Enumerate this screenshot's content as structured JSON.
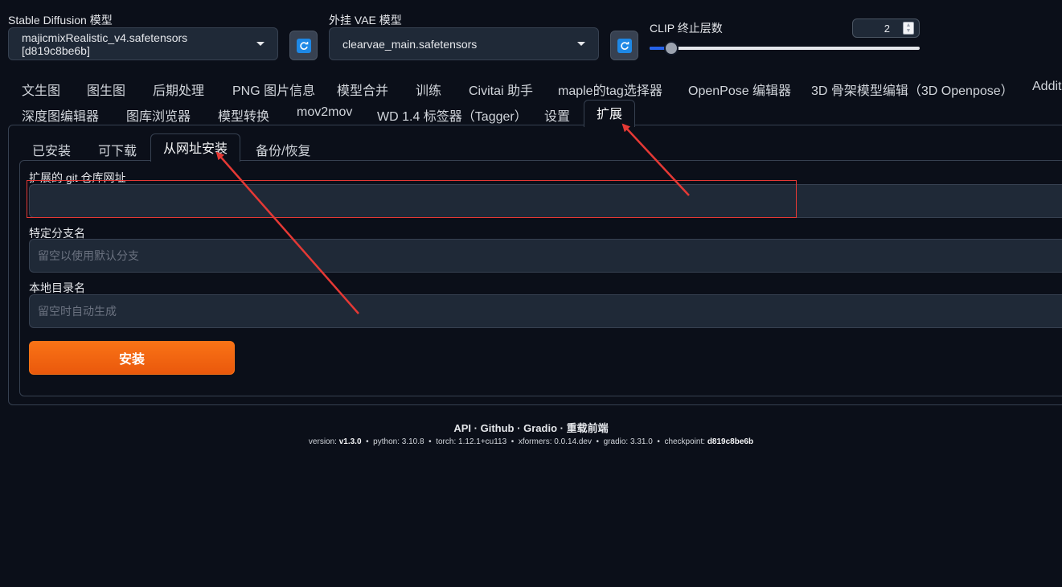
{
  "header": {
    "sd_model_label": "Stable Diffusion 模型",
    "sd_model_value": "majicmixRealistic_v4.safetensors [d819c8be6b]",
    "vae_label": "外挂 VAE 模型",
    "vae_value": "clearvae_main.safetensors",
    "clip_label": "CLIP 终止层数",
    "clip_value": "2",
    "clip_slider_fraction": 0.08,
    "icons": {
      "refresh": "refresh-icon",
      "dropdown": "chevron-down-icon"
    }
  },
  "tabs_row1": [
    "文生图",
    "图生图",
    "后期处理",
    "PNG 图片信息",
    "模型合并",
    "训练",
    "Civitai 助手",
    "maple的tag选择器",
    "OpenPose 编辑器",
    "3D 骨架模型编辑（3D Openpose）",
    "Additi"
  ],
  "tabs_row2": [
    "深度图编辑器",
    "图库浏览器",
    "模型转换",
    "mov2mov",
    "WD 1.4 标签器（Tagger）",
    "设置",
    "扩展"
  ],
  "active_tab": "扩展",
  "subtabs": [
    "已安装",
    "可下载",
    "从网址安装",
    "备份/恢复"
  ],
  "active_subtab": "从网址安装",
  "form": {
    "git_url_label": "扩展的 git 仓库网址",
    "git_url_value": "",
    "branch_label": "特定分支名",
    "branch_placeholder": "留空以使用默认分支",
    "dir_label": "本地目录名",
    "dir_placeholder": "留空时自动生成",
    "install_label": "安装"
  },
  "footer": {
    "links": [
      "API",
      "Github",
      "Gradio",
      "重载前端"
    ],
    "separator": "·",
    "version_label": "version:",
    "version_value": "v1.3.0",
    "python_label": "python:",
    "python_value": "3.10.8",
    "torch_label": "torch:",
    "torch_value": "1.12.1+cu113",
    "xformers_label": "xformers:",
    "xformers_value": "0.0.14.dev",
    "gradio_label": "gradio:",
    "gradio_value": "3.31.0",
    "checkpoint_label": "checkpoint:",
    "checkpoint_value": "d819c8be6b",
    "bullet": "•"
  },
  "colors": {
    "background": "#0b0f19",
    "accent": "#f97316",
    "annotation": "#e53935"
  }
}
